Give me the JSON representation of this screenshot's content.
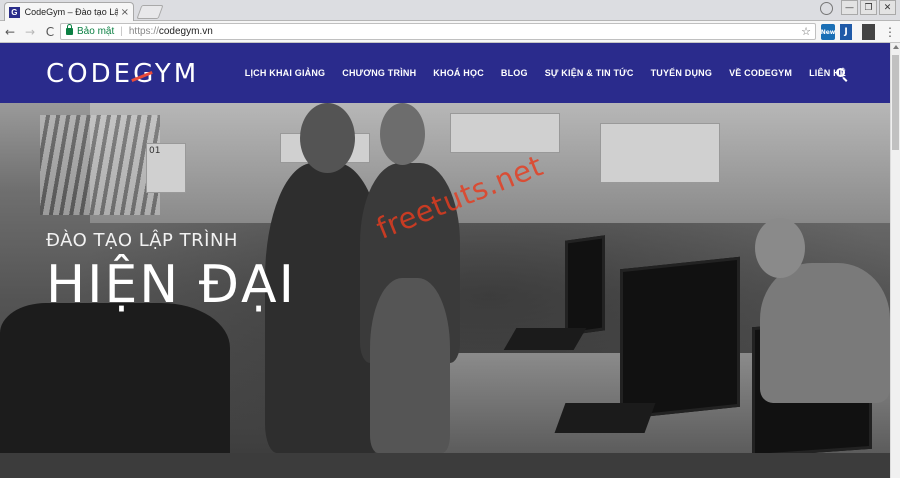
{
  "browser": {
    "tab_title": "CodeGym – Đào tạo Lập",
    "tab_close": "×",
    "favicon_letter": "G",
    "secure_label": "Bảo mật",
    "url_proto": "https://",
    "url_host": "codegym.vn",
    "back_icon": "←",
    "forward_icon": "→",
    "reload_icon": "C",
    "star_icon": "☆",
    "ext_badge": "New",
    "ext2_letter": "J",
    "menu_icon": "⋮",
    "win_min": "—",
    "win_restore": "❐",
    "win_close": "✕"
  },
  "site": {
    "logo_text": "CODEGYM",
    "brand_color": "#2a2b8c",
    "accent_color": "#e84a3a",
    "nav": [
      {
        "label": "LỊCH KHAI GIẢNG"
      },
      {
        "label": "CHƯƠNG TRÌNH"
      },
      {
        "label": "KHOÁ HỌC"
      },
      {
        "label": "BLOG"
      },
      {
        "label": "SỰ KIỆN & TIN TỨC"
      },
      {
        "label": "TUYỂN DỤNG"
      },
      {
        "label": "VỀ CODEGYM"
      },
      {
        "label": "LIÊN HỆ"
      }
    ]
  },
  "hero": {
    "subtitle": "ĐÀO TẠO LẬP TRÌNH",
    "title": "HIỆN ĐẠI",
    "watermark": "freetuts.net",
    "paper_label": "01"
  }
}
